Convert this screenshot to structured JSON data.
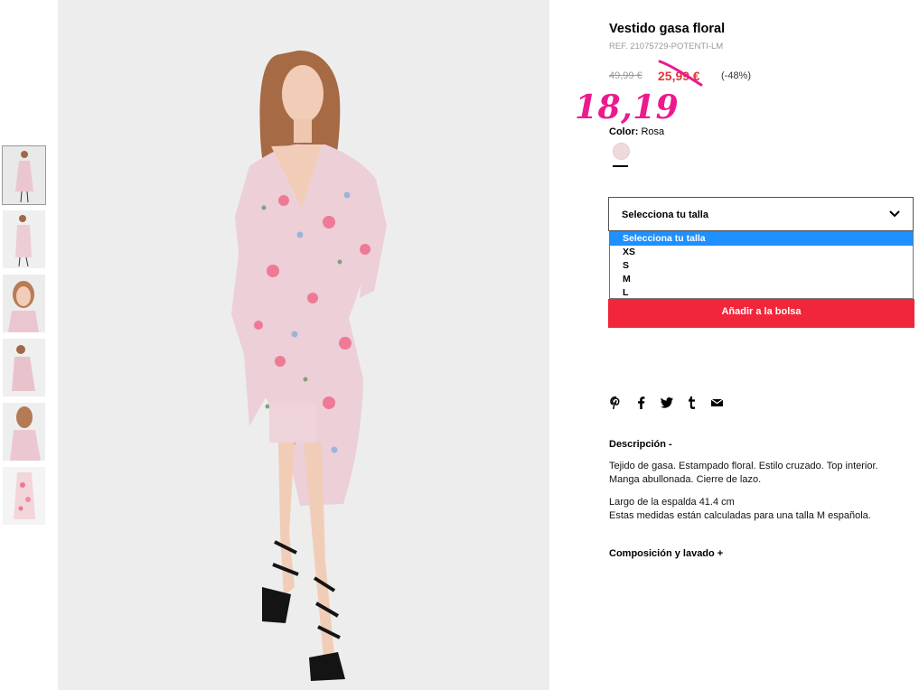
{
  "product": {
    "title": "Vestido gasa floral",
    "ref": "REF. 21075729-POTENTI-LM",
    "old_price": "49,99 €",
    "sale_price": "25,99 €",
    "discount": "(-48%)",
    "handwritten_price": "18,19",
    "color_label": "Color:",
    "color_value": "Rosa",
    "swatch_color": "#f0d9dd"
  },
  "size": {
    "select_label": "Selecciona tu talla",
    "options": [
      "Selecciona tu talla",
      "XS",
      "S",
      "M",
      "L"
    ]
  },
  "cart": {
    "add_label": "Añadir a la bolsa"
  },
  "colors": {
    "sale": "#e03a3a",
    "add_button": "#f1263b",
    "handwriting": "#ec1a8e",
    "selected_option": "#1e90ff"
  },
  "share_icons": [
    "pinterest-icon",
    "facebook-icon",
    "twitter-icon",
    "tumblr-icon",
    "email-icon"
  ],
  "description": {
    "heading": "Descripción  -",
    "text1": "Tejido de gasa. Estampado floral. Estilo cruzado. Top interior.",
    "text2": "Manga abullonada. Cierre de lazo.",
    "text3": "Largo de la espalda 41.4 cm",
    "text4": "Estas medidas están calculadas para una talla M española."
  },
  "composition": {
    "heading": "Composición y lavado  +"
  }
}
